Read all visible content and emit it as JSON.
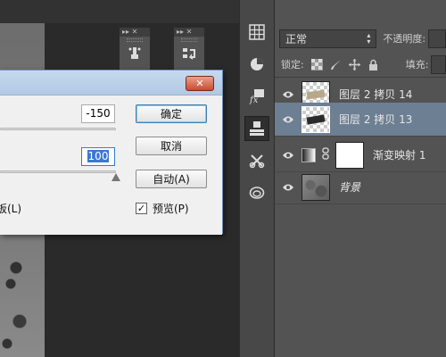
{
  "dialog": {
    "field1_value": "-150",
    "field2_value": "100",
    "ok_label": "确定",
    "cancel_label": "取消",
    "auto_label": "自动(A)",
    "partial_label": "板(L)",
    "preview_label": "预览(P)",
    "preview_checked": true,
    "close_glyph": "✕"
  },
  "layers_panel": {
    "blend_mode": "正常",
    "opacity_label": "不透明度:",
    "lock_label": "锁定:",
    "fill_label": "填充:",
    "layers": [
      {
        "name": "图层 2 拷贝 14",
        "selected": false
      },
      {
        "name": "图层 2 拷贝 13",
        "selected": true
      },
      {
        "name": "渐变映射 1",
        "selected": false
      },
      {
        "name": "背景",
        "selected": false
      }
    ]
  },
  "mini_panels": {
    "panel_head_glyphs": "▸▸ ✕"
  },
  "colors": {
    "selected_layer": "#6d7f93",
    "close_button": "#c84b32",
    "text_highlight": "#3b78d6"
  }
}
